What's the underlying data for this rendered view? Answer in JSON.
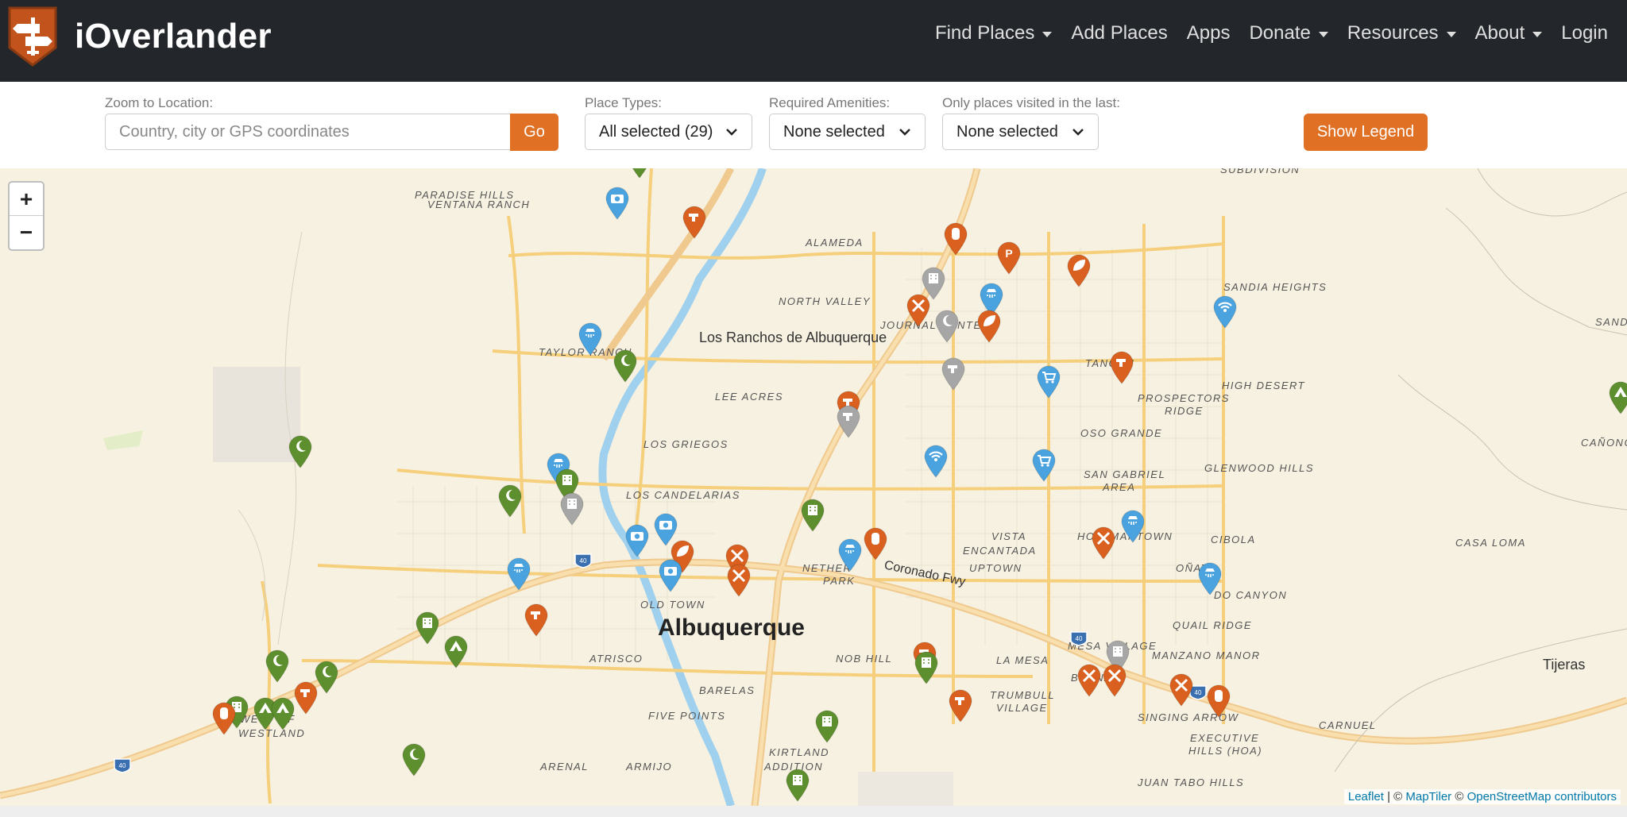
{
  "navbar": {
    "brand": "iOverlander",
    "items": [
      {
        "label": "Find Places",
        "dropdown": true
      },
      {
        "label": "Add Places",
        "dropdown": false
      },
      {
        "label": "Apps",
        "dropdown": false
      },
      {
        "label": "Donate",
        "dropdown": true
      },
      {
        "label": "Resources",
        "dropdown": true
      },
      {
        "label": "About",
        "dropdown": true
      },
      {
        "label": "Login",
        "dropdown": false
      }
    ]
  },
  "filters": {
    "zoom_label": "Zoom to Location:",
    "search_placeholder": "Country, city or GPS coordinates",
    "go_label": "Go",
    "place_types_label": "Place Types:",
    "place_types_value": "All selected (29)",
    "amenities_label": "Required Amenities:",
    "amenities_value": "None selected",
    "visited_label": "Only places visited in the last:",
    "visited_value": "None selected",
    "legend_button": "Show Legend"
  },
  "map": {
    "zoom_in": "+",
    "zoom_out": "−",
    "attribution_leaflet": "Leaflet",
    "attribution_sep": " | © ",
    "attribution_maptiler": "MapTiler",
    "attribution_sep2": " © ",
    "attribution_osm": "OpenStreetMap contributors",
    "labels": {
      "city": "Albuquerque",
      "los_ranchos": "Los Ranchos de Albuquerque",
      "tijeras": "Tijeras",
      "coronado": "Coronado Fwy",
      "paradise_hills": "PARADISE HILLS",
      "ventana_ranch": "VENTANA RANCH",
      "alameda": "ALAMEDA",
      "north_valley": "NORTH VALLEY",
      "taylor_ranch": "TAYLOR RANCH",
      "lee_acres": "LEE ACRES",
      "los_griegos": "LOS GRIEGOS",
      "los_candelarias": "LOS CANDELARIAS",
      "old_town": "OLD TOWN",
      "atrisco": "ATRISCO",
      "barelas": "BARELAS",
      "five_points": "FIVE POINTS",
      "arenal": "ARENAL",
      "armijo": "ARMIJO",
      "west_of": "WEST OF",
      "westland": "WESTLAND",
      "kirtland": "KIRTLAND",
      "addition": "ADDITION",
      "nob_hill": "NOB HILL",
      "nether": "NETHER",
      "park": "PARK",
      "vista": "VISTA",
      "encantada": "ENCANTADA",
      "uptown": "UPTOWN",
      "hoffmantown": "HOFFMANTOWN",
      "la_mesa": "LA MESA",
      "trumbull": "TRUMBULL",
      "village": "VILLAGE",
      "buena": "BUENA",
      "mesa_village": "MESA VILLAGE",
      "manzano_manor": "MANZANO MANOR",
      "singing_arrow": "SINGING ARROW",
      "executive": "EXECUTIVE",
      "hills_hoa": "HILLS (HOA)",
      "juan_tabo_hills": "JUAN TABO HILLS",
      "carnuel": "CARNUEL",
      "quail_ridge": "QUAIL RIDGE",
      "onate": "OÑATE",
      "cibola": "CIBOLA",
      "casa_loma": "CASA LOMA",
      "glenwood_hills": "GLENWOOD HILLS",
      "san_gabriel": "SAN GABRIEL",
      "area": "AREA",
      "oso_grande": "OSO GRANDE",
      "prospectors": "PROSPECTORS",
      "ridge": "RIDGE",
      "tanoan": "TANOAN",
      "high_desert": "HIGH DESERT",
      "sandia_heights": "SANDIA HEIGHTS",
      "subdivision": "SUBDIVISION",
      "journal_center": "JOURNAL CENTER",
      "canoncito": "CAÑONCI",
      "sandia": "SAND",
      "do_canyon": "DO CANYON",
      "i40_a": "40",
      "i40_b": "40",
      "i40_c": "40",
      "i40_d": "40"
    }
  },
  "colors": {
    "nav_bg": "#23272b",
    "accent": "#e07024",
    "marker_green": "#5e8f2e",
    "marker_blue": "#4aa3df",
    "marker_orange": "#d9601f",
    "marker_gray": "#a6a6a6"
  }
}
